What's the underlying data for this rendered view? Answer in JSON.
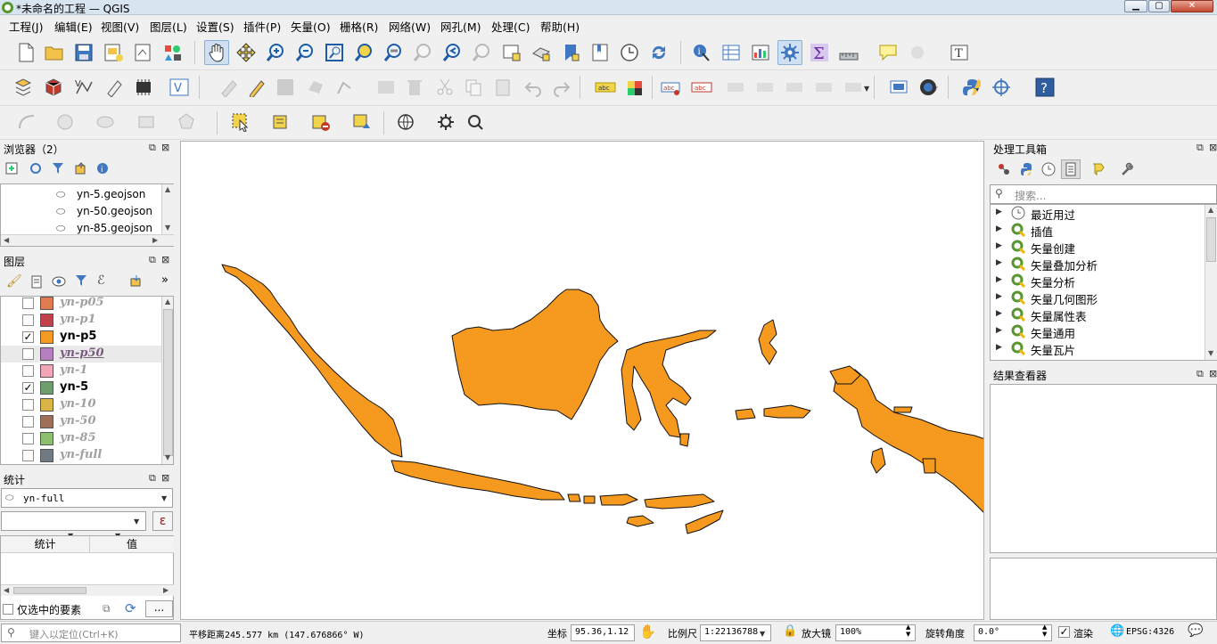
{
  "window": {
    "title": "*未命名的工程 — QGIS"
  },
  "menu": [
    "工程(J)",
    "编辑(E)",
    "视图(V)",
    "图层(L)",
    "设置(S)",
    "插件(P)",
    "矢量(O)",
    "栅格(R)",
    "网络(W)",
    "网孔(M)",
    "处理(C)",
    "帮助(H)"
  ],
  "browser": {
    "title": "浏览器（2）",
    "items": [
      "yn-5.geojson",
      "yn-50.geojson",
      "yn-85.geojson"
    ]
  },
  "layers": {
    "title": "图层",
    "items": [
      {
        "name": "yn-p05",
        "checked": false,
        "visible": false,
        "color": "#e07a4f"
      },
      {
        "name": "yn-p1",
        "checked": false,
        "visible": false,
        "color": "#c1414a"
      },
      {
        "name": "yn-p5",
        "checked": true,
        "visible": true,
        "color": "#f59a23"
      },
      {
        "name": "yn-p50",
        "checked": false,
        "visible": false,
        "color": "#b67fc0"
      },
      {
        "name": "yn-1",
        "checked": false,
        "visible": false,
        "color": "#f2a5b6"
      },
      {
        "name": "yn-5",
        "checked": true,
        "visible": true,
        "color": "#6e9e6c"
      },
      {
        "name": "yn-10",
        "checked": false,
        "visible": false,
        "color": "#d8b545"
      },
      {
        "name": "yn-50",
        "checked": false,
        "visible": false,
        "color": "#a06f57"
      },
      {
        "name": "yn-85",
        "checked": false,
        "visible": false,
        "color": "#8cbf6d"
      },
      {
        "name": "yn-full",
        "checked": false,
        "visible": false,
        "color": "#6f7a82"
      }
    ]
  },
  "stats": {
    "title": "统计",
    "layer": "yn-full",
    "col_stat": "统计",
    "col_value": "值",
    "selected_only": "仅选中的要素",
    "expr_btn": "ε",
    "more_btn": "..."
  },
  "toolbox": {
    "title": "处理工具箱",
    "search_placeholder": "搜索...",
    "items": [
      "最近用过",
      "插值",
      "矢量创建",
      "矢量叠加分析",
      "矢量分析",
      "矢量几何图形",
      "矢量属性表",
      "矢量通用",
      "矢量瓦片"
    ]
  },
  "results": {
    "title": "结果查看器"
  },
  "status": {
    "locate_placeholder": "键入以定位(Ctrl+K)",
    "pan_info": "平移距离245.577 km (147.676866° W)",
    "coord_label": "坐标",
    "coord": "95.36,1.12",
    "scale_label": "比例尺",
    "scale": "1:22136788",
    "magnifier_label": "放大镜",
    "magnifier": "100%",
    "rotation_label": "旋转角度",
    "rotation": "0.0°",
    "render_label": "渲染",
    "crs": "EPSG:4326"
  },
  "colors": {
    "fill": "#f59a1e",
    "accent": "#589632"
  }
}
